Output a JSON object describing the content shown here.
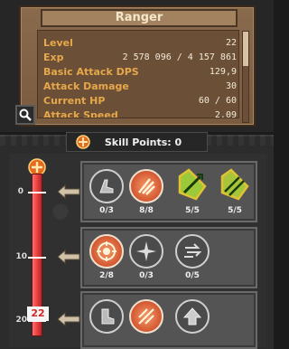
{
  "stats_panel": {
    "title": "Ranger",
    "rows": [
      {
        "label": "Level",
        "value": "22"
      },
      {
        "label": "Exp",
        "value": "2 578 096 / 4 157 861"
      },
      {
        "label": "Basic Attack DPS",
        "value": "129,9"
      },
      {
        "label": "Attack Damage",
        "value": "30"
      },
      {
        "label": "Current HP",
        "value": "60 / 60"
      },
      {
        "label": "Attack Speed",
        "value": "2,09"
      }
    ]
  },
  "skill_points_label": "Skill Points: 0",
  "level_track": {
    "current_level": "22",
    "ticks": [
      "0",
      "10",
      "20"
    ]
  },
  "skill_rows": [
    {
      "skills": [
        {
          "icon": "boot-icon",
          "count": "0/3"
        },
        {
          "icon": "flame-claw-icon",
          "count": "8/8"
        },
        {
          "icon": "green-arrow-icon",
          "count": "5/5"
        },
        {
          "icon": "green-arrows-icon",
          "count": "5/5"
        }
      ]
    },
    {
      "skills": [
        {
          "icon": "target-icon",
          "count": "2/8"
        },
        {
          "icon": "shuriken-icon",
          "count": "0/3"
        },
        {
          "icon": "wind-icon",
          "count": "0/5"
        }
      ]
    },
    {
      "skills": [
        {
          "icon": "armor-boot-icon",
          "count": ""
        },
        {
          "icon": "fire-slash-icon",
          "count": ""
        },
        {
          "icon": "up-arrow-icon",
          "count": ""
        }
      ]
    }
  ]
}
